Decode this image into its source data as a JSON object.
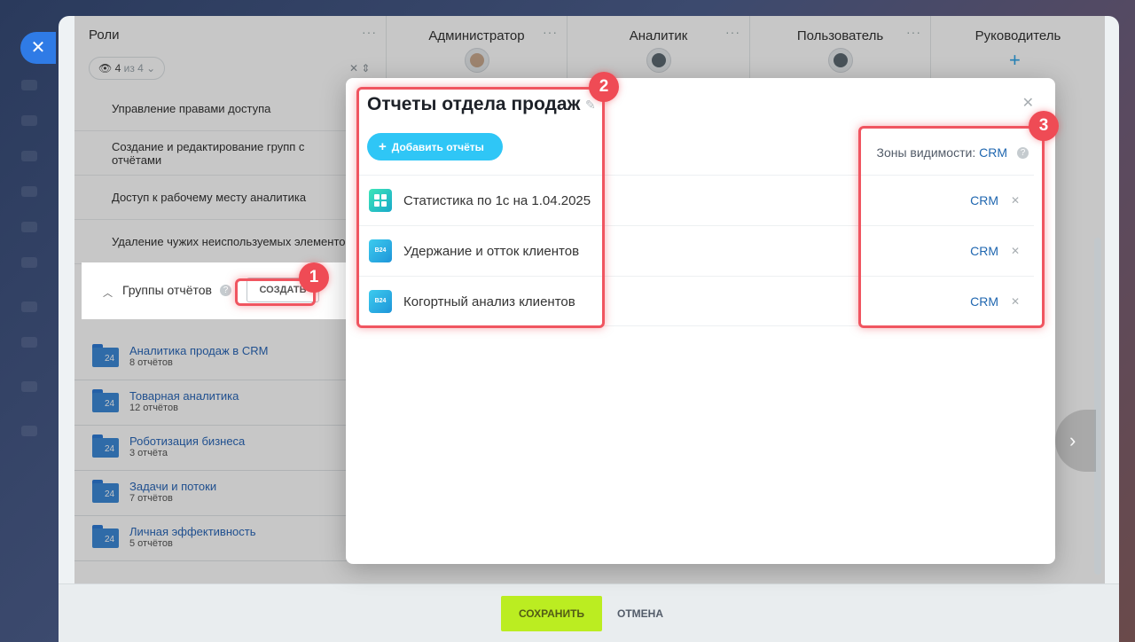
{
  "roles": {
    "label": "Роли",
    "filter_count": "4",
    "filter_of": "из 4"
  },
  "columns": [
    {
      "title": "Администратор",
      "avatar": "photo"
    },
    {
      "title": "Аналитик",
      "avatar": "generic"
    },
    {
      "title": "Пользователь",
      "avatar": "generic"
    },
    {
      "title": "Руководитель",
      "avatar": "add"
    }
  ],
  "permissions": [
    "Управление правами доступа",
    "Создание и редактирование групп с отчётами",
    "Доступ к рабочему месту аналитика",
    "Удаление чужих неиспользуемых элементов"
  ],
  "groups": {
    "label": "Группы отчётов",
    "create_label": "СОЗДАТЬ",
    "folder_badge": "24",
    "folders": [
      {
        "title": "Аналитика продаж в CRM",
        "count": "8 отчётов"
      },
      {
        "title": "Товарная аналитика",
        "count": "12 отчётов"
      },
      {
        "title": "Роботизация бизнеса",
        "count": "3 отчёта"
      },
      {
        "title": "Задачи и потоки",
        "count": "7 отчётов"
      },
      {
        "title": "Личная эффективность",
        "count": "5 отчётов"
      }
    ]
  },
  "popup": {
    "title": "Отчеты отдела продаж",
    "add_label": "Добавить отчёты",
    "zones_label": "Зоны видимости:",
    "zones_value": "CRM",
    "reports": [
      {
        "title": "Статистика по 1с на 1.04.2025",
        "icon": "stat-icon",
        "zone": "CRM"
      },
      {
        "title": "Удержание и отток клиентов",
        "icon": "b24-icon",
        "zone": "CRM"
      },
      {
        "title": "Когортный анализ клиентов",
        "icon": "b24-icon",
        "zone": "CRM"
      }
    ]
  },
  "footer": {
    "save_label": "СОХРАНИТЬ",
    "cancel_label": "ОТМЕНА"
  },
  "annotations": [
    "1",
    "2",
    "3"
  ],
  "colors": {
    "accent_blue": "#2fc6f6",
    "link_blue": "#2067b0",
    "save_green": "#bbed21",
    "annotation_red": "#ef4b55"
  }
}
